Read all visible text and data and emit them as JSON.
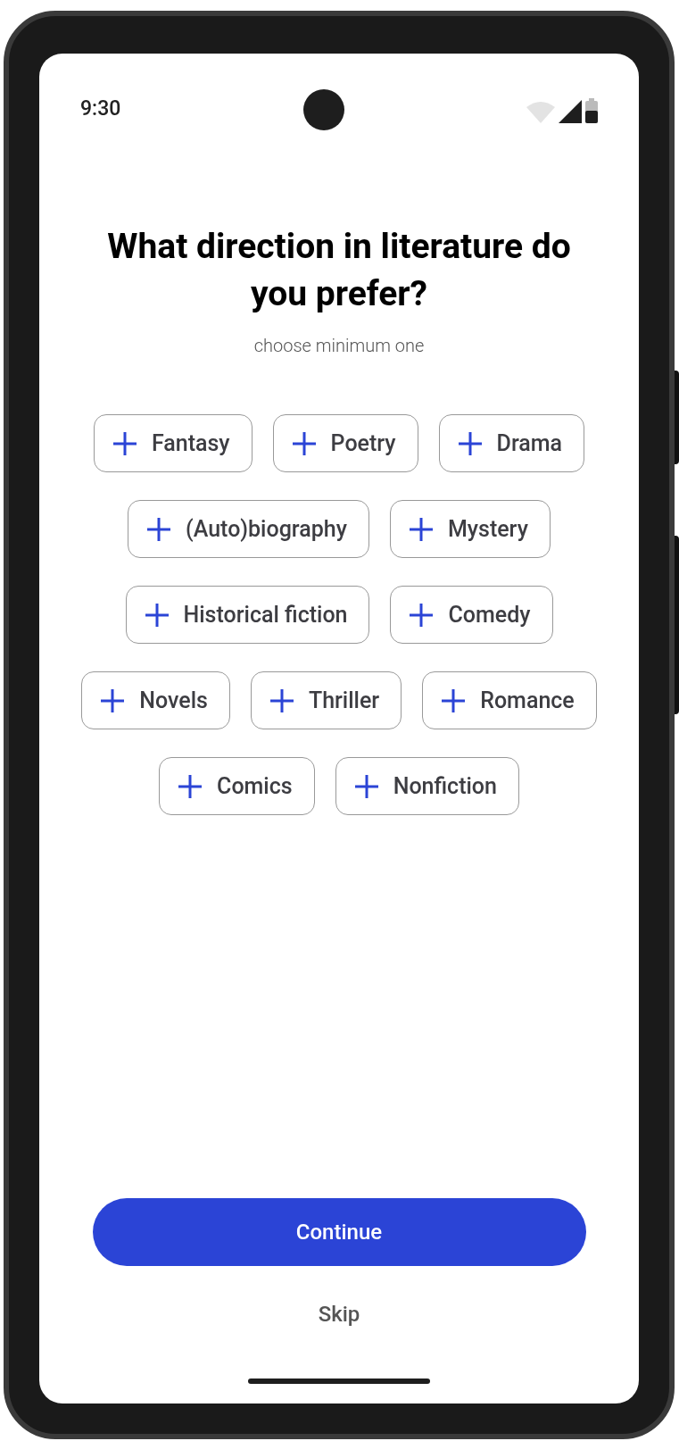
{
  "status_bar": {
    "time": "9:30"
  },
  "title": "What direction in literature do you prefer?",
  "subtitle": "choose minimum one",
  "chip_rows": [
    [
      {
        "label": "Fantasy",
        "selected": false
      },
      {
        "label": "Poetry",
        "selected": false
      },
      {
        "label": "Drama",
        "selected": false
      }
    ],
    [
      {
        "label": "(Auto)biography",
        "selected": false
      },
      {
        "label": "Mystery",
        "selected": false
      }
    ],
    [
      {
        "label": "Historical fiction",
        "selected": false
      },
      {
        "label": "Comedy",
        "selected": false
      }
    ],
    [
      {
        "label": "Novels",
        "selected": false
      },
      {
        "label": "Thriller",
        "selected": false
      },
      {
        "label": "Romance",
        "selected": false
      }
    ],
    [
      {
        "label": "Comics",
        "selected": false
      },
      {
        "label": "Nonfiction",
        "selected": false
      }
    ]
  ],
  "primary_button": "Continue",
  "secondary_button": "Skip"
}
